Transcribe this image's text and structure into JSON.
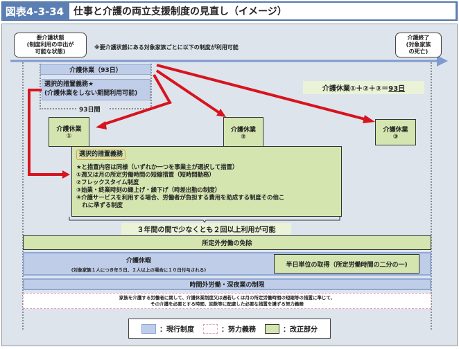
{
  "header": {
    "figure_label": "図表4-3-34",
    "title": "仕事と介護の両立支援制度の見直し（イメージ）"
  },
  "timeline": {
    "start_line1": "要介護状態",
    "start_line2": "(制度利用の申出が",
    "start_line3": "可能な状態)",
    "end_line1": "介護終了",
    "end_line2": "(対象家族",
    "end_line3": "の死亡)",
    "note": "※要介護状態にある対象家族ごとに以下の制度が利用可能"
  },
  "leave": {
    "main": "介護休業（93日）",
    "selective_line1": "選択的措置義務★",
    "selective_line2": "(介護休業をしない期間利用可能)",
    "period": "93日間",
    "formula_prefix": "介護休業①＋②＋③＝",
    "formula_total": "93日",
    "parts": [
      {
        "label": "介護休業",
        "num": "①"
      },
      {
        "label": "介護休業",
        "num": "②"
      },
      {
        "label": "介護休業",
        "num": "③"
      }
    ]
  },
  "selective": {
    "title": "選択的措置義務",
    "lines": [
      "★と措置内容は同様（いずれか一つを事業主が選択して措置）",
      "①週又は月の所定労働時間の短縮措置（短時間勤務）",
      "②フレックスタイム制度",
      "③始業・終業時刻の繰上げ・繰下げ（時差出勤の制度）",
      "④介護サービスを利用する場合、労働者が負担する費用を助成する制度その他こ",
      "　れに準ずる制度"
    ],
    "usage": "３年間の間で少なくとも２回以上利用が可能"
  },
  "rows": {
    "overtime_exempt": "所定外労働の免除",
    "care_leave": "介護休暇",
    "care_leave_note": "(対象家族１人につき年５日、２人以上の場合に１０日付与される)",
    "half_day": "半日単位の取得（所定労働時間の二分の一)",
    "overtime_limit": "時間外労働・深夜業の制限",
    "effort_line1": "家族を介護する労働者に関して、介護休業制度又は週若しくは月の所定労働時間の短縮等の措置に準じて、",
    "effort_line2": "その介護を必要とする時間、回数等に配慮した必要な措置を講ずる努力義務"
  },
  "legend": {
    "current": "：現行制度",
    "effort": "：努力義務",
    "revised": "：改正部分"
  },
  "colors": {
    "current": "#bfcde9",
    "revised": "#d4e5b0",
    "arrow": "#d7141e",
    "timeline": "#7d9bd0",
    "effort_border": "#e6a0c0"
  }
}
